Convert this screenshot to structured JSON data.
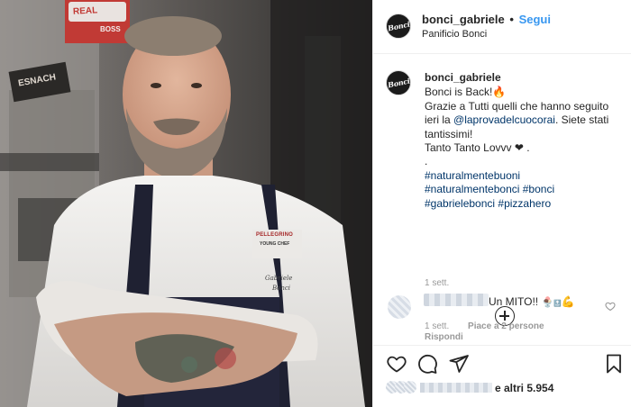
{
  "post": {
    "photo_signs": {
      "sign_top": "REAL",
      "sign_top_sub": "BOSS",
      "sign_left": "ESNACH",
      "jacket_brand": "PELLEGRINO",
      "jacket_sub": "YOUNG CHEF",
      "jacket_name_1": "Gabriele",
      "jacket_name_2": "Bonci"
    }
  },
  "header": {
    "avatar_text": "Bonci",
    "username": "bonci_gabriele",
    "separator": "•",
    "follow_label": "Segui",
    "location": "Panificio Bonci"
  },
  "caption": {
    "avatar_text": "Bonci",
    "username": "bonci_gabriele",
    "line1": "Bonci is Back!",
    "line1_emoji": "🔥",
    "line2_pre": "Grazie a Tutti quelli che hanno seguito ieri la ",
    "mention": "@laprovadelcuocorai",
    "line2_post": ". Siete stati tantissimi!",
    "line3": "Tanto Tanto Lovvv ❤ .",
    "line4": ".",
    "hashtag1": "#naturalmentebuoni",
    "hashtag2": "#naturalmentebonci",
    "hashtag3": "#bonci",
    "hashtag4": "#gabrielebonci",
    "hashtag5": "#pizzahero",
    "time": "1 sett."
  },
  "comment": {
    "text": "Un MITO!!",
    "emoji_a": "🍨",
    "emoji_b": "🔝",
    "emoji_c": "💪",
    "time": "1 sett.",
    "likes": "Piace a 2 persone",
    "reply_label": "Rispondi"
  },
  "likes_summary": {
    "text": "e altri 5.954"
  },
  "icons": {
    "load_more": "plus-circle-icon",
    "like": "heart-icon",
    "comment": "speech-bubble-icon",
    "share": "paper-plane-icon",
    "save": "bookmark-icon"
  },
  "colors": {
    "follow": "#3897f0",
    "link": "#003569",
    "muted": "#999999",
    "text": "#262626"
  }
}
